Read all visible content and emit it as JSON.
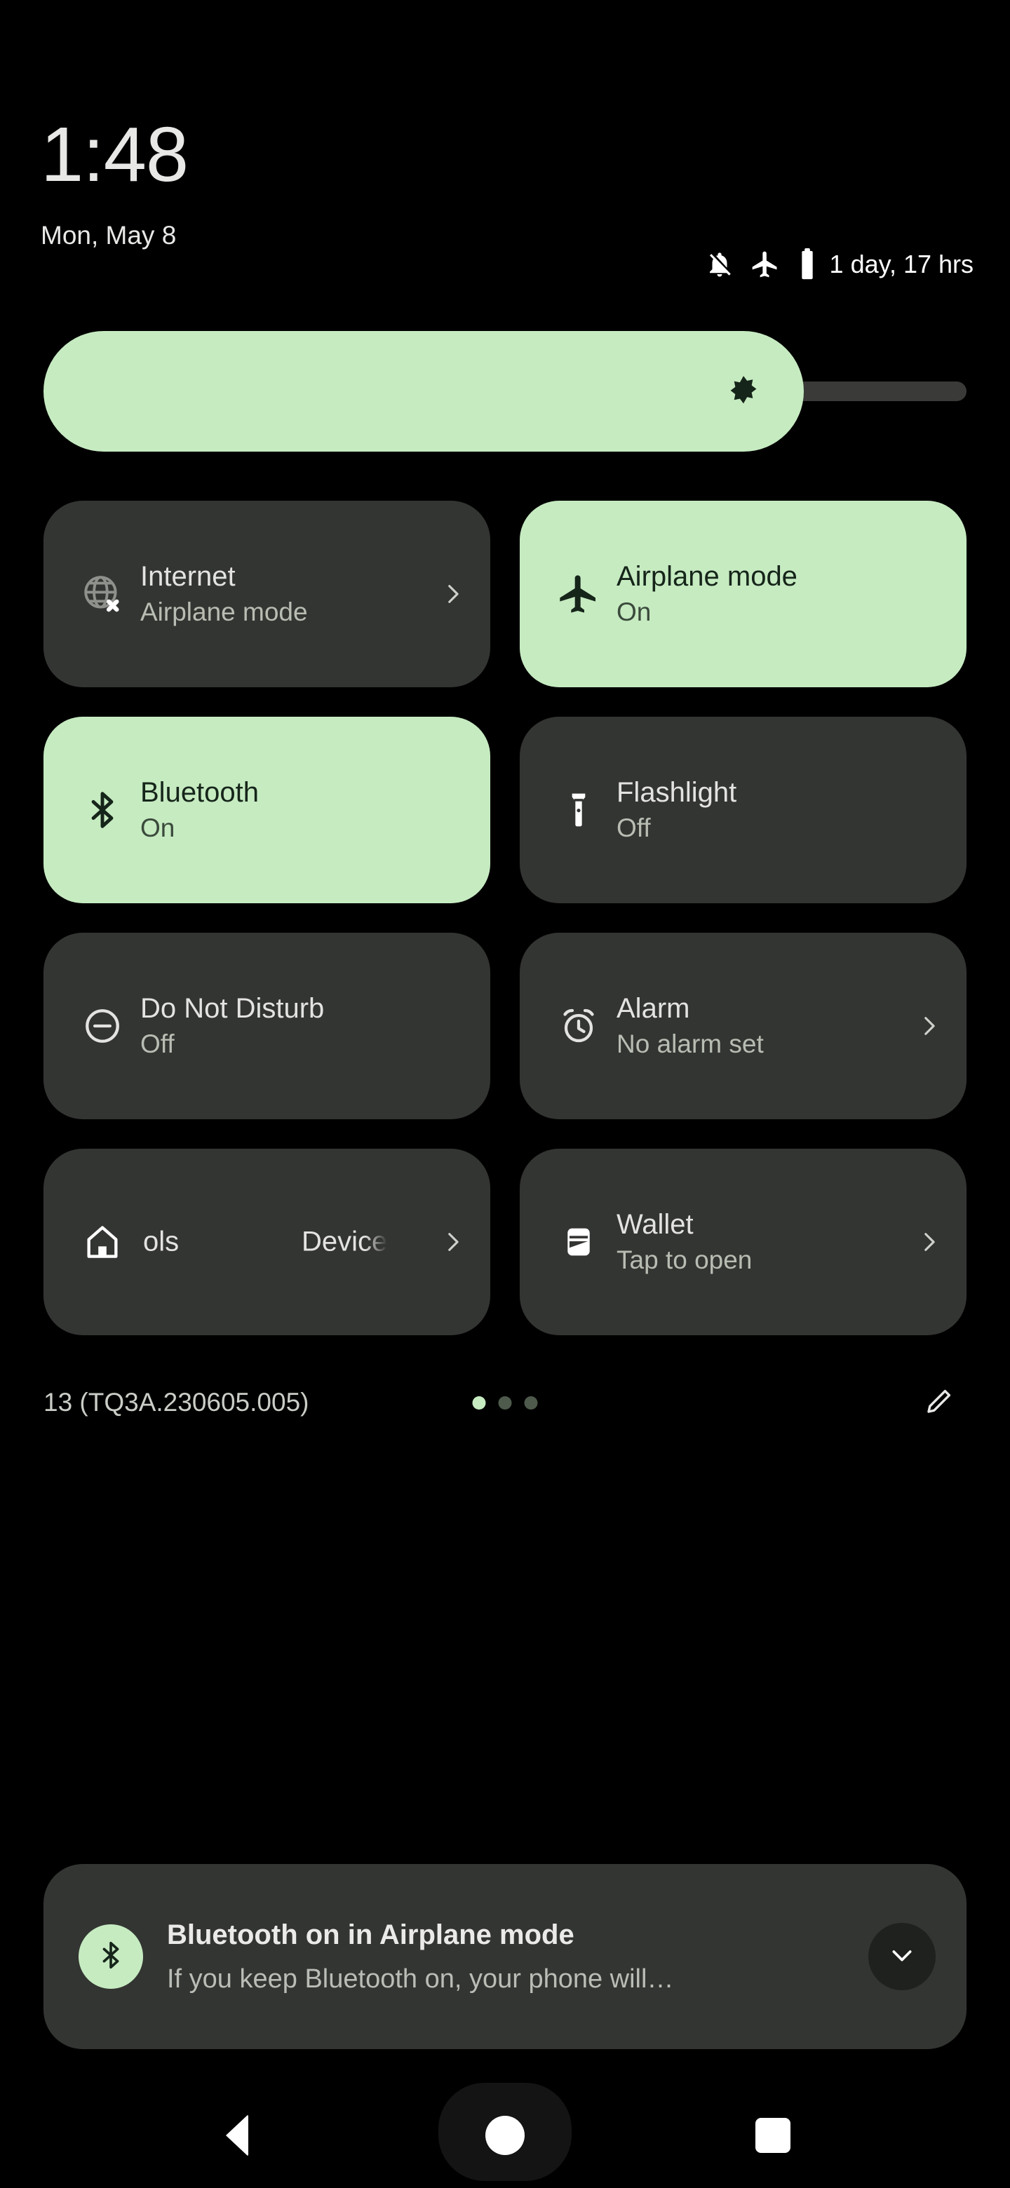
{
  "statusbar": {
    "time": "1:48",
    "date": "Mon, May 8",
    "icons": [
      "notifications-off-icon",
      "airplane-icon",
      "battery-icon"
    ],
    "battery_text": "1 day, 17 hrs"
  },
  "brightness": {
    "name": "brightness-slider",
    "icon": "brightness-icon",
    "fill_percent": 78,
    "accent": "#c6ebc1",
    "track": "#3a3a38"
  },
  "tiles": [
    {
      "label": "Internet",
      "sub": "Airplane mode",
      "icon": "globe-off-icon",
      "active": false,
      "chevron": true
    },
    {
      "label": "Airplane mode",
      "sub": "On",
      "icon": "airplane-icon",
      "active": true,
      "chevron": false
    },
    {
      "label": "Bluetooth",
      "sub": "On",
      "icon": "bluetooth-icon",
      "active": true,
      "chevron": false
    },
    {
      "label": "Flashlight",
      "sub": "Off",
      "icon": "flashlight-icon",
      "active": false,
      "chevron": false
    },
    {
      "label": "Do Not Disturb",
      "sub": "Off",
      "icon": "do-not-disturb-icon",
      "active": false,
      "chevron": false
    },
    {
      "label": "Alarm",
      "sub": "No alarm set",
      "icon": "alarm-icon",
      "active": false,
      "chevron": true
    },
    {
      "label_part_a": "ols",
      "label_part_b": "Device",
      "full_label": "Device controls",
      "icon": "home-icon",
      "active": false,
      "chevron": true
    },
    {
      "label": "Wallet",
      "sub": "Tap to open",
      "icon": "wallet-icon",
      "active": false,
      "chevron": true
    }
  ],
  "footer": {
    "build": "13 (TQ3A.230605.005)",
    "pages": 3,
    "active_page": 1,
    "edit_icon": "pencil-icon"
  },
  "notification": {
    "icon": "bluetooth-icon",
    "title": "Bluetooth on in Airplane mode",
    "body": "If you keep Bluetooth on, your phone will…",
    "expand_icon": "chevron-down-icon"
  },
  "navbar": {
    "back": "back-button",
    "home": "home-button",
    "recents": "recents-button"
  },
  "colors": {
    "background": "#000000",
    "tile_inactive": "#333532",
    "tile_active": "#c6ebc1",
    "text_primary": "#e3e3e1",
    "text_secondary": "#b8bdb3"
  }
}
